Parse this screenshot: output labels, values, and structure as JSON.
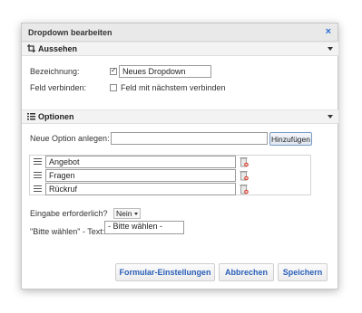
{
  "dialog": {
    "title": "Dropdown bearbeiten",
    "close_glyph": "×"
  },
  "sections": {
    "appearance": {
      "title": "Aussehen",
      "icon": "crop-icon"
    },
    "options": {
      "title": "Optionen",
      "icon": "list-icon"
    }
  },
  "appearance": {
    "label_name": "Bezeichnung:",
    "name_checked": true,
    "name_value": "Neues Dropdown",
    "label_link": "Feld verbinden:",
    "link_checked": false,
    "link_text": "Feld mit nächstem verbinden"
  },
  "options": {
    "new_label": "Neue Option anlegen:",
    "new_value": "",
    "add_button": "Hinzufügen",
    "items": [
      {
        "label": "Angebot"
      },
      {
        "label": "Fragen"
      },
      {
        "label": "Rückruf"
      }
    ]
  },
  "required": {
    "label": "Eingabe erforderlich?",
    "value": "Nein"
  },
  "please_choose": {
    "label": "\"Bitte wählen\" - Text:",
    "value": "- Bitte wählen -"
  },
  "footer": {
    "form_settings": "Formular-Einstellungen",
    "cancel": "Abbrechen",
    "save": "Speichern"
  }
}
